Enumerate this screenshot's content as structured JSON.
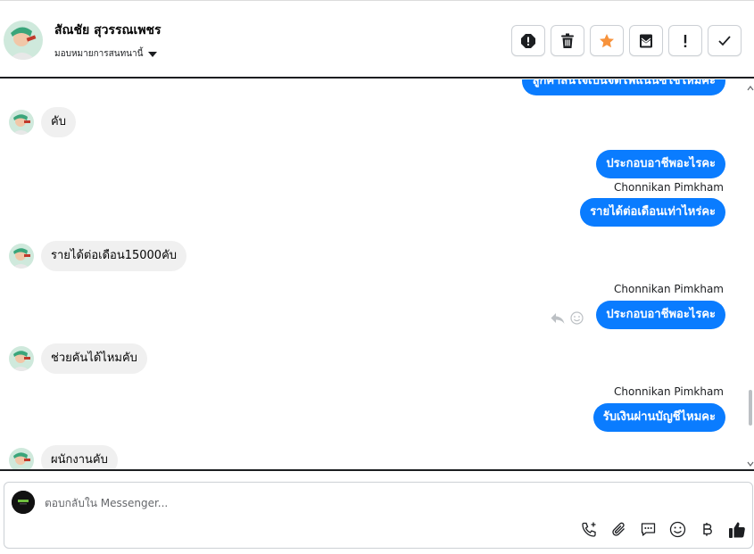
{
  "header": {
    "contact_name": "สัณชัย สุวรรณเพชร",
    "assign_label": "มอบหมายการสนทนานี้",
    "actions": [
      {
        "icon": "alert-icon",
        "name": "mark-spam-button"
      },
      {
        "icon": "trash-icon",
        "name": "delete-button"
      },
      {
        "icon": "star-icon",
        "name": "star-button"
      },
      {
        "icon": "envelope-icon",
        "name": "mark-unread-button"
      },
      {
        "icon": "exclamation-icon",
        "name": "follow-up-button"
      },
      {
        "icon": "check-icon",
        "name": "mark-done-button"
      }
    ]
  },
  "colors": {
    "accent": "#0a7cff",
    "star": "#f7923b",
    "incoming_bubble": "#f0f0f0"
  },
  "messages": {
    "m0": {
      "text": "ลูกค้าสนใจเป็นจัดไฟแนนซ์ใช่ไหมคะ"
    },
    "m1": {
      "text": "คับ"
    },
    "m2": {
      "text": "ประกอบอาชีพอะไรคะ"
    },
    "m3": {
      "sender": "Chonnikan Pimkham",
      "text": "รายได้ต่อเดือนเท่าไหร่คะ"
    },
    "m4": {
      "text": "รายได้ต่อเดือน15000คับ"
    },
    "m5": {
      "sender": "Chonnikan Pimkham",
      "text": "ประกอบอาชีพอะไรคะ"
    },
    "m6": {
      "text": "ช่วยคันได้ไหมคับ"
    },
    "m7": {
      "sender": "Chonnikan Pimkham",
      "text": "รับเงินผ่านบัญชีไหมคะ"
    },
    "m8": {
      "text": "ผนักงานคับ"
    }
  },
  "composer": {
    "placeholder": "ตอบกลับใน Messenger...",
    "tools": [
      "call-add-icon",
      "attachment-icon",
      "saved-reply-icon",
      "emoji-icon",
      "baht-icon",
      "like-icon"
    ]
  }
}
